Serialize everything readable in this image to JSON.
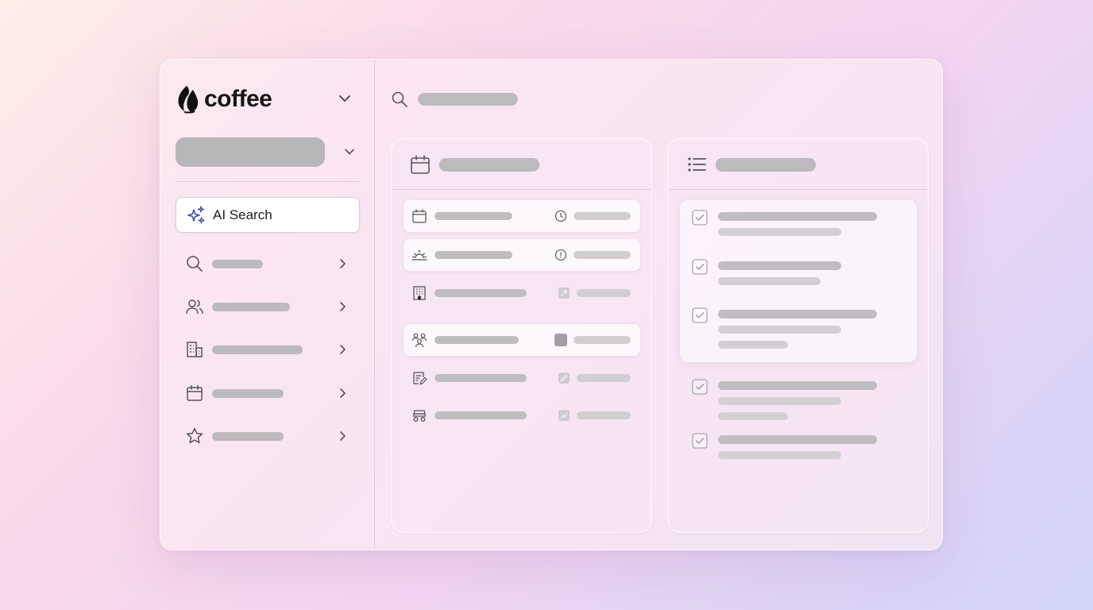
{
  "app": {
    "logo_text": "coffee",
    "ai_search_label": "AI Search"
  },
  "sidebar": {
    "items": [
      {
        "icon": "search-icon"
      },
      {
        "icon": "people-icon"
      },
      {
        "icon": "building-icon"
      },
      {
        "icon": "calendar-icon"
      },
      {
        "icon": "star-icon"
      }
    ]
  },
  "panels": {
    "calendar_panel": {
      "icon": "calendar-icon"
    },
    "tasks_panel": {
      "icon": "list-icon"
    }
  },
  "colors": {
    "ai_accent": "#3f4fa8",
    "placeholder": "#bdbabd"
  }
}
